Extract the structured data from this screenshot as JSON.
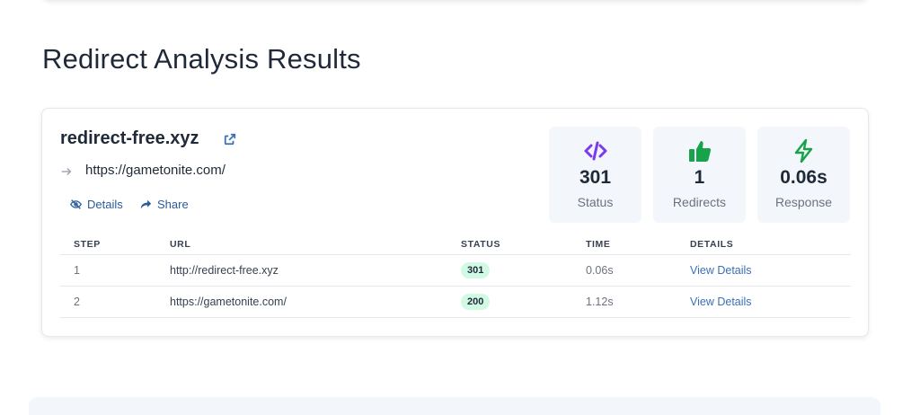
{
  "page_title": "Redirect Analysis Results",
  "result": {
    "domain": "redirect-free.xyz",
    "final_url": "https://gametonite.com/",
    "actions": {
      "details": "Details",
      "share": "Share"
    },
    "stats": [
      {
        "value": "301",
        "label": "Status",
        "icon": "code-icon",
        "color": "#7c3aed"
      },
      {
        "value": "1",
        "label": "Redirects",
        "icon": "thumbs-up-icon",
        "color": "#16a34a"
      },
      {
        "value": "0.06s",
        "label": "Response",
        "icon": "lightning-icon",
        "color": "#16a34a"
      }
    ],
    "table": {
      "headers": [
        "STEP",
        "URL",
        "STATUS",
        "TIME",
        "DETAILS"
      ],
      "rows": [
        {
          "step": "1",
          "url": "http://redirect-free.xyz",
          "status": "301",
          "time": "0.06s",
          "details": "View Details"
        },
        {
          "step": "2",
          "url": "https://gametonite.com/",
          "status": "200",
          "time": "1.12s",
          "details": "View Details"
        }
      ]
    }
  },
  "colors": {
    "link": "#3b6fb5",
    "badge_bg": "#d1fae5",
    "stat_bg": "#f3f6fb"
  }
}
